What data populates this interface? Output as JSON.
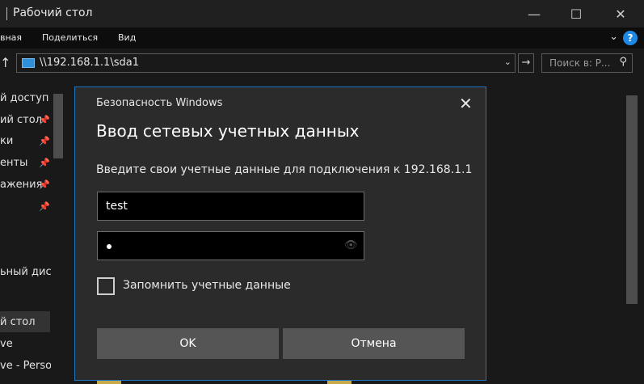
{
  "window": {
    "title": "Рабочий стол",
    "minimize": "—",
    "maximize": "☐",
    "close": "✕"
  },
  "ribbon": {
    "tabs": [
      "вная",
      "Поделиться",
      "Вид"
    ],
    "expand": "⌄",
    "help": "?"
  },
  "navbar": {
    "up": "↑",
    "address": "\\\\192.168.1.1\\sda1",
    "dropdown": "⌄",
    "go": "→",
    "search_placeholder": "Поиск в: Р...",
    "search_icon": "⚲"
  },
  "nav_pane": {
    "items": [
      {
        "label": "й доступ",
        "pinned": false
      },
      {
        "label": "ий стол",
        "pinned": true
      },
      {
        "label": "ки",
        "pinned": true
      },
      {
        "label": "енты",
        "pinned": true
      },
      {
        "label": "ажения",
        "pinned": true
      },
      {
        "label": "",
        "pinned": true
      },
      {
        "label": "ьный диск",
        "pinned": false
      },
      {
        "label": "й стол",
        "pinned": false,
        "selected": true
      },
      {
        "label": "ve",
        "pinned": false
      },
      {
        "label": "ve - Person",
        "pinned": false
      }
    ],
    "pin_icon": "📌"
  },
  "dialog": {
    "caption": "Безопасность Windows",
    "close": "✕",
    "heading": "Ввод сетевых учетных данных",
    "description": "Введите свои учетные данные для подключения к 192.168.1.1",
    "username_value": "test",
    "eye_icon": "👁",
    "remember_label": "Запомнить учетные данные",
    "remember_checked": false,
    "ok_label": "OK",
    "cancel_label": "Отмена"
  },
  "colors": {
    "accent": "#1f76c2",
    "dialog_bg": "#2b2b2b",
    "button_bg": "#555555"
  }
}
